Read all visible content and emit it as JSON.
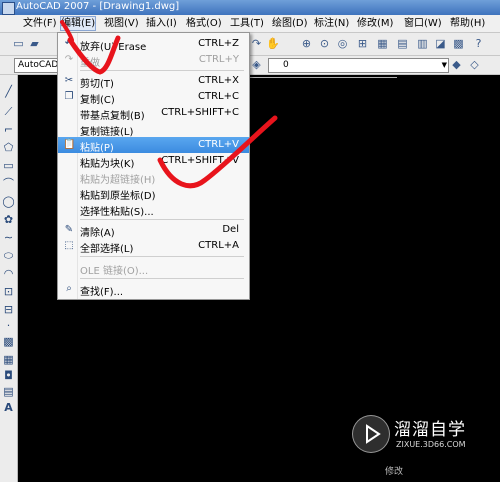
{
  "window": {
    "title": "AutoCAD 2007 - [Drawing1.dwg]"
  },
  "menubar": {
    "items": [
      "文件(F)",
      "编辑(E)",
      "视图(V)",
      "插入(I)",
      "格式(O)",
      "工具(T)",
      "绘图(D)",
      "标注(N)",
      "修改(M)",
      "窗口(W)",
      "帮助(H)"
    ],
    "active_index": 1
  },
  "toolbar": {
    "layer_combo": "AutoCAD 经",
    "layer_value": "0"
  },
  "edit_menu": {
    "items": [
      {
        "label": "放弃(U) Erase",
        "shortcut": "CTRL+Z",
        "icon": "undo-icon",
        "enabled": true
      },
      {
        "label": "重做",
        "shortcut": "CTRL+Y",
        "icon": "redo-icon",
        "enabled": false
      },
      {
        "label": "剪切(T)",
        "shortcut": "CTRL+X",
        "icon": "scissors-icon",
        "enabled": true
      },
      {
        "label": "复制(C)",
        "shortcut": "CTRL+C",
        "icon": "copy-icon",
        "enabled": true
      },
      {
        "label": "带基点复制(B)",
        "shortcut": "CTRL+SHIFT+C",
        "icon": "",
        "enabled": true
      },
      {
        "label": "复制链接(L)",
        "shortcut": "",
        "icon": "",
        "enabled": true
      },
      {
        "label": "粘贴(P)",
        "shortcut": "CTRL+V",
        "icon": "paste-icon",
        "enabled": true,
        "highlighted": true
      },
      {
        "label": "粘贴为块(K)",
        "shortcut": "CTRL+SHIFT+V",
        "icon": "",
        "enabled": true
      },
      {
        "label": "粘贴为超链接(H)",
        "shortcut": "",
        "icon": "",
        "enabled": false
      },
      {
        "label": "粘贴到原坐标(D)",
        "shortcut": "",
        "icon": "",
        "enabled": true
      },
      {
        "label": "选择性粘贴(S)...",
        "shortcut": "",
        "icon": "",
        "enabled": true
      },
      {
        "label": "清除(A)",
        "shortcut": "Del",
        "icon": "eraser-icon",
        "enabled": true
      },
      {
        "label": "全部选择(L)",
        "shortcut": "CTRL+A",
        "icon": "select-all-icon",
        "enabled": true
      },
      {
        "label": "OLE 链接(O)...",
        "shortcut": "",
        "icon": "",
        "enabled": false
      },
      {
        "label": "查找(F)...",
        "shortcut": "",
        "icon": "find-icon",
        "enabled": true
      }
    ]
  },
  "watermark": {
    "title": "溜溜自学",
    "subtitle": "ZIXUE.3D66.COM"
  },
  "bottom_text": "修改",
  "colors": {
    "highlight": "#3b8be0",
    "scribble": "#e8141c",
    "canvas": "#000000"
  }
}
